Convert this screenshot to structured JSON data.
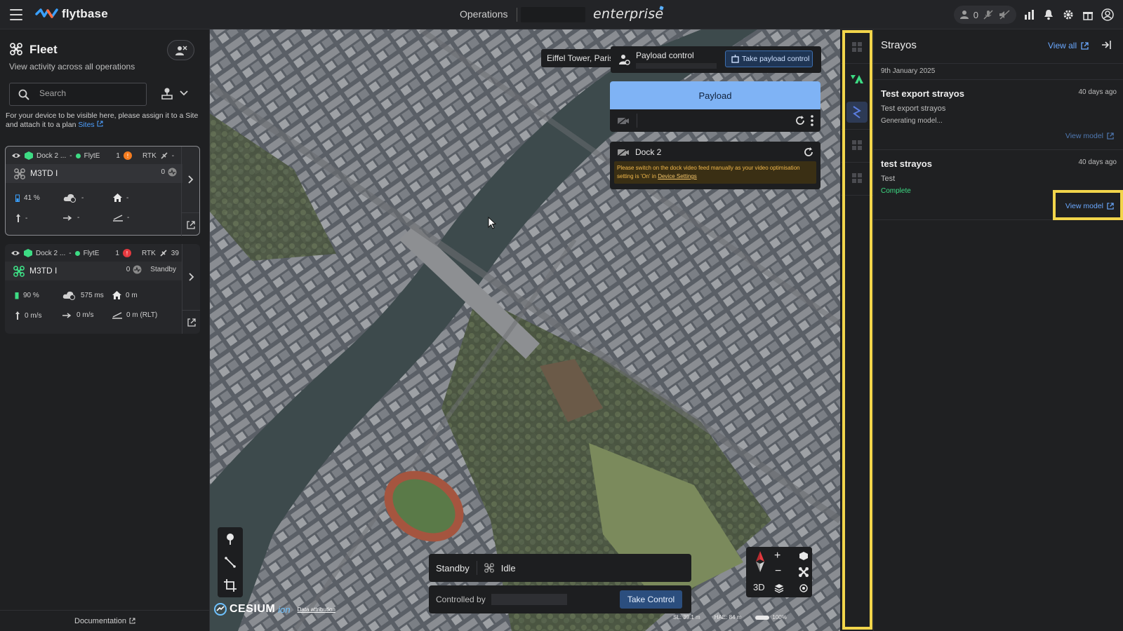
{
  "topbar": {
    "brand": "flytbase",
    "operations_label": "Operations",
    "edition": "enterprise",
    "user_count": "0"
  },
  "fleet": {
    "title": "Fleet",
    "subtitle": "View activity across all operations",
    "search_placeholder": "Search",
    "notice": "For your device to be visible here, please assign it to a Site and attach it to a plan",
    "notice_link": "Sites",
    "documentation": "Documentation",
    "devices": [
      {
        "dock": "Dock 2 ...",
        "dash": "-",
        "network": "FlytE",
        "count": "1",
        "rtk": "RTK",
        "rtk_value": "-",
        "drone": "M3TD I",
        "drone_count": "0",
        "state": "",
        "battery": "41 %",
        "latency": "-",
        "home": "-",
        "v_speed": "-",
        "h_speed": "-",
        "altitude": "-"
      },
      {
        "dock": "Dock 2 ...",
        "dash": "-",
        "network": "FlytE",
        "count": "1",
        "rtk": "RTK",
        "rtk_value": "39",
        "drone": "M3TD I",
        "drone_count": "0",
        "state": "Standby",
        "battery": "90 %",
        "latency": "575 ms",
        "home": "0 m",
        "v_speed": "0 m/s",
        "h_speed": "0 m/s",
        "altitude": "0 m (RLT)"
      }
    ]
  },
  "map": {
    "location": "Eiffel Tower, Paris",
    "payload_control_label": "Payload control",
    "take_payload_control": "Take payload control",
    "payload_title": "Payload",
    "dock_title": "Dock 2",
    "dock_warning": "Please switch on the dock video feed manually as your video optimisation setting is 'On' in",
    "dock_warning_link": "Device Settings",
    "status_standby": "Standby",
    "status_idle": "Idle",
    "controlled_by": "Controlled by",
    "take_control": "Take Control",
    "view_mode": "3D",
    "cesium": "CESIUM",
    "cesium_ion": "ion",
    "data_attribution": "Data attribution",
    "msl": "SL: 39.1 m",
    "hae": "HAE: 84 m",
    "zoom": "100%"
  },
  "strayos": {
    "title": "Strayos",
    "view_all": "View all",
    "date": "9th January 2025",
    "models": [
      {
        "title": "Test export strayos",
        "age": "40 days ago",
        "description": "Test export strayos",
        "status": "Generating model...",
        "action": "View model"
      },
      {
        "title": "test strayos",
        "age": "40 days ago",
        "description": "Test",
        "status": "Complete",
        "action": "View model"
      }
    ]
  },
  "colors": {
    "accent_blue": "#6aa8ff",
    "highlight_yellow": "#f2d54b",
    "success_green": "#3ddc84",
    "warning_orange": "#f2b84b"
  }
}
